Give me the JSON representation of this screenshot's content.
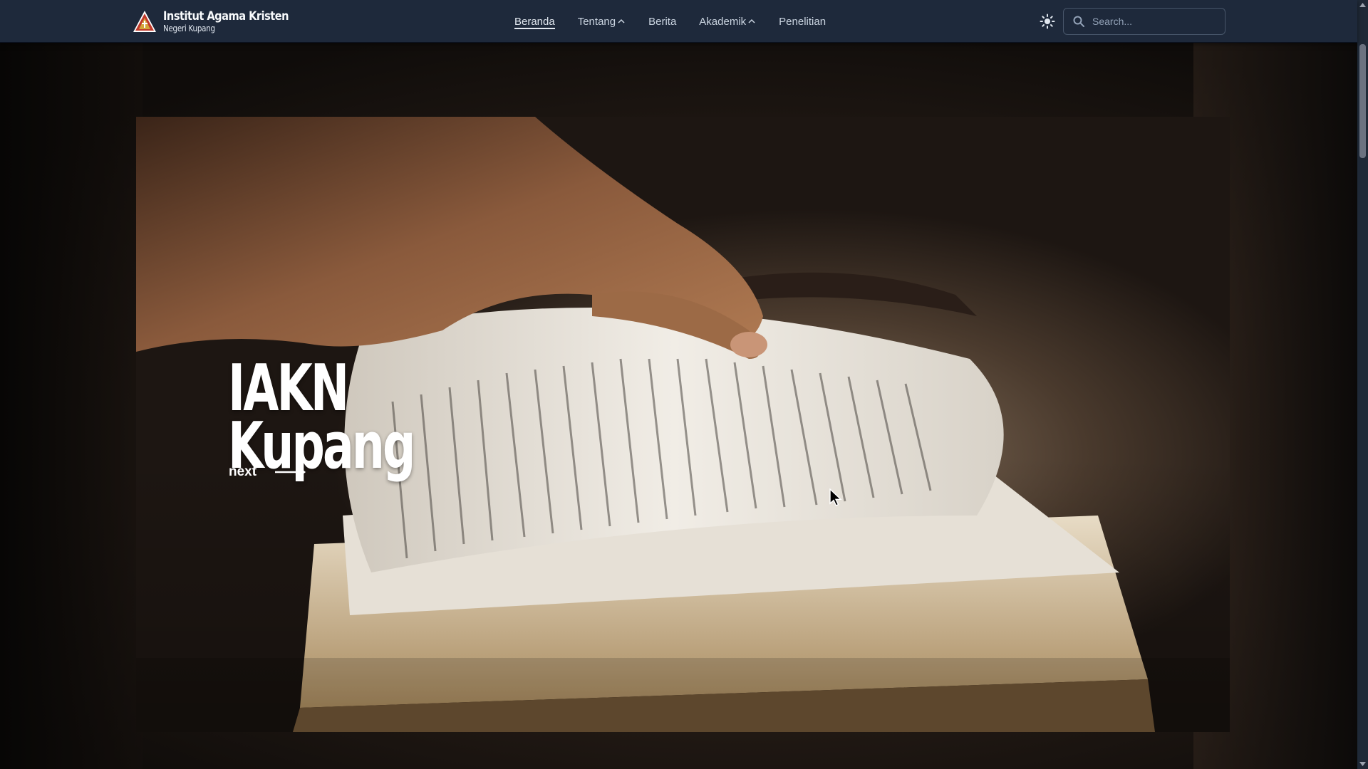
{
  "brand": {
    "title": "Institut Agama Kristen",
    "subtitle": "Negeri Kupang",
    "logo_icon": "triangle-logo-icon"
  },
  "nav": {
    "items": [
      {
        "label": "Beranda",
        "active": true,
        "has_dropdown": false
      },
      {
        "label": "Tentang",
        "active": false,
        "has_dropdown": true
      },
      {
        "label": "Berita",
        "active": false,
        "has_dropdown": false
      },
      {
        "label": "Akademik",
        "active": false,
        "has_dropdown": true
      },
      {
        "label": "Penelitian",
        "active": false,
        "has_dropdown": false
      }
    ]
  },
  "header": {
    "theme_toggle_icon": "sun-icon",
    "search": {
      "placeholder": "Search...",
      "value": ""
    }
  },
  "hero": {
    "title_line1": "IAKN",
    "title_line2": "Kupang",
    "next_label": "next"
  },
  "colors": {
    "navbar_bg": "#1e293b",
    "text_light": "#e2e8f0",
    "muted": "#94a3b8",
    "logo_red": "#c0392b",
    "logo_gold": "#d4a53a"
  }
}
